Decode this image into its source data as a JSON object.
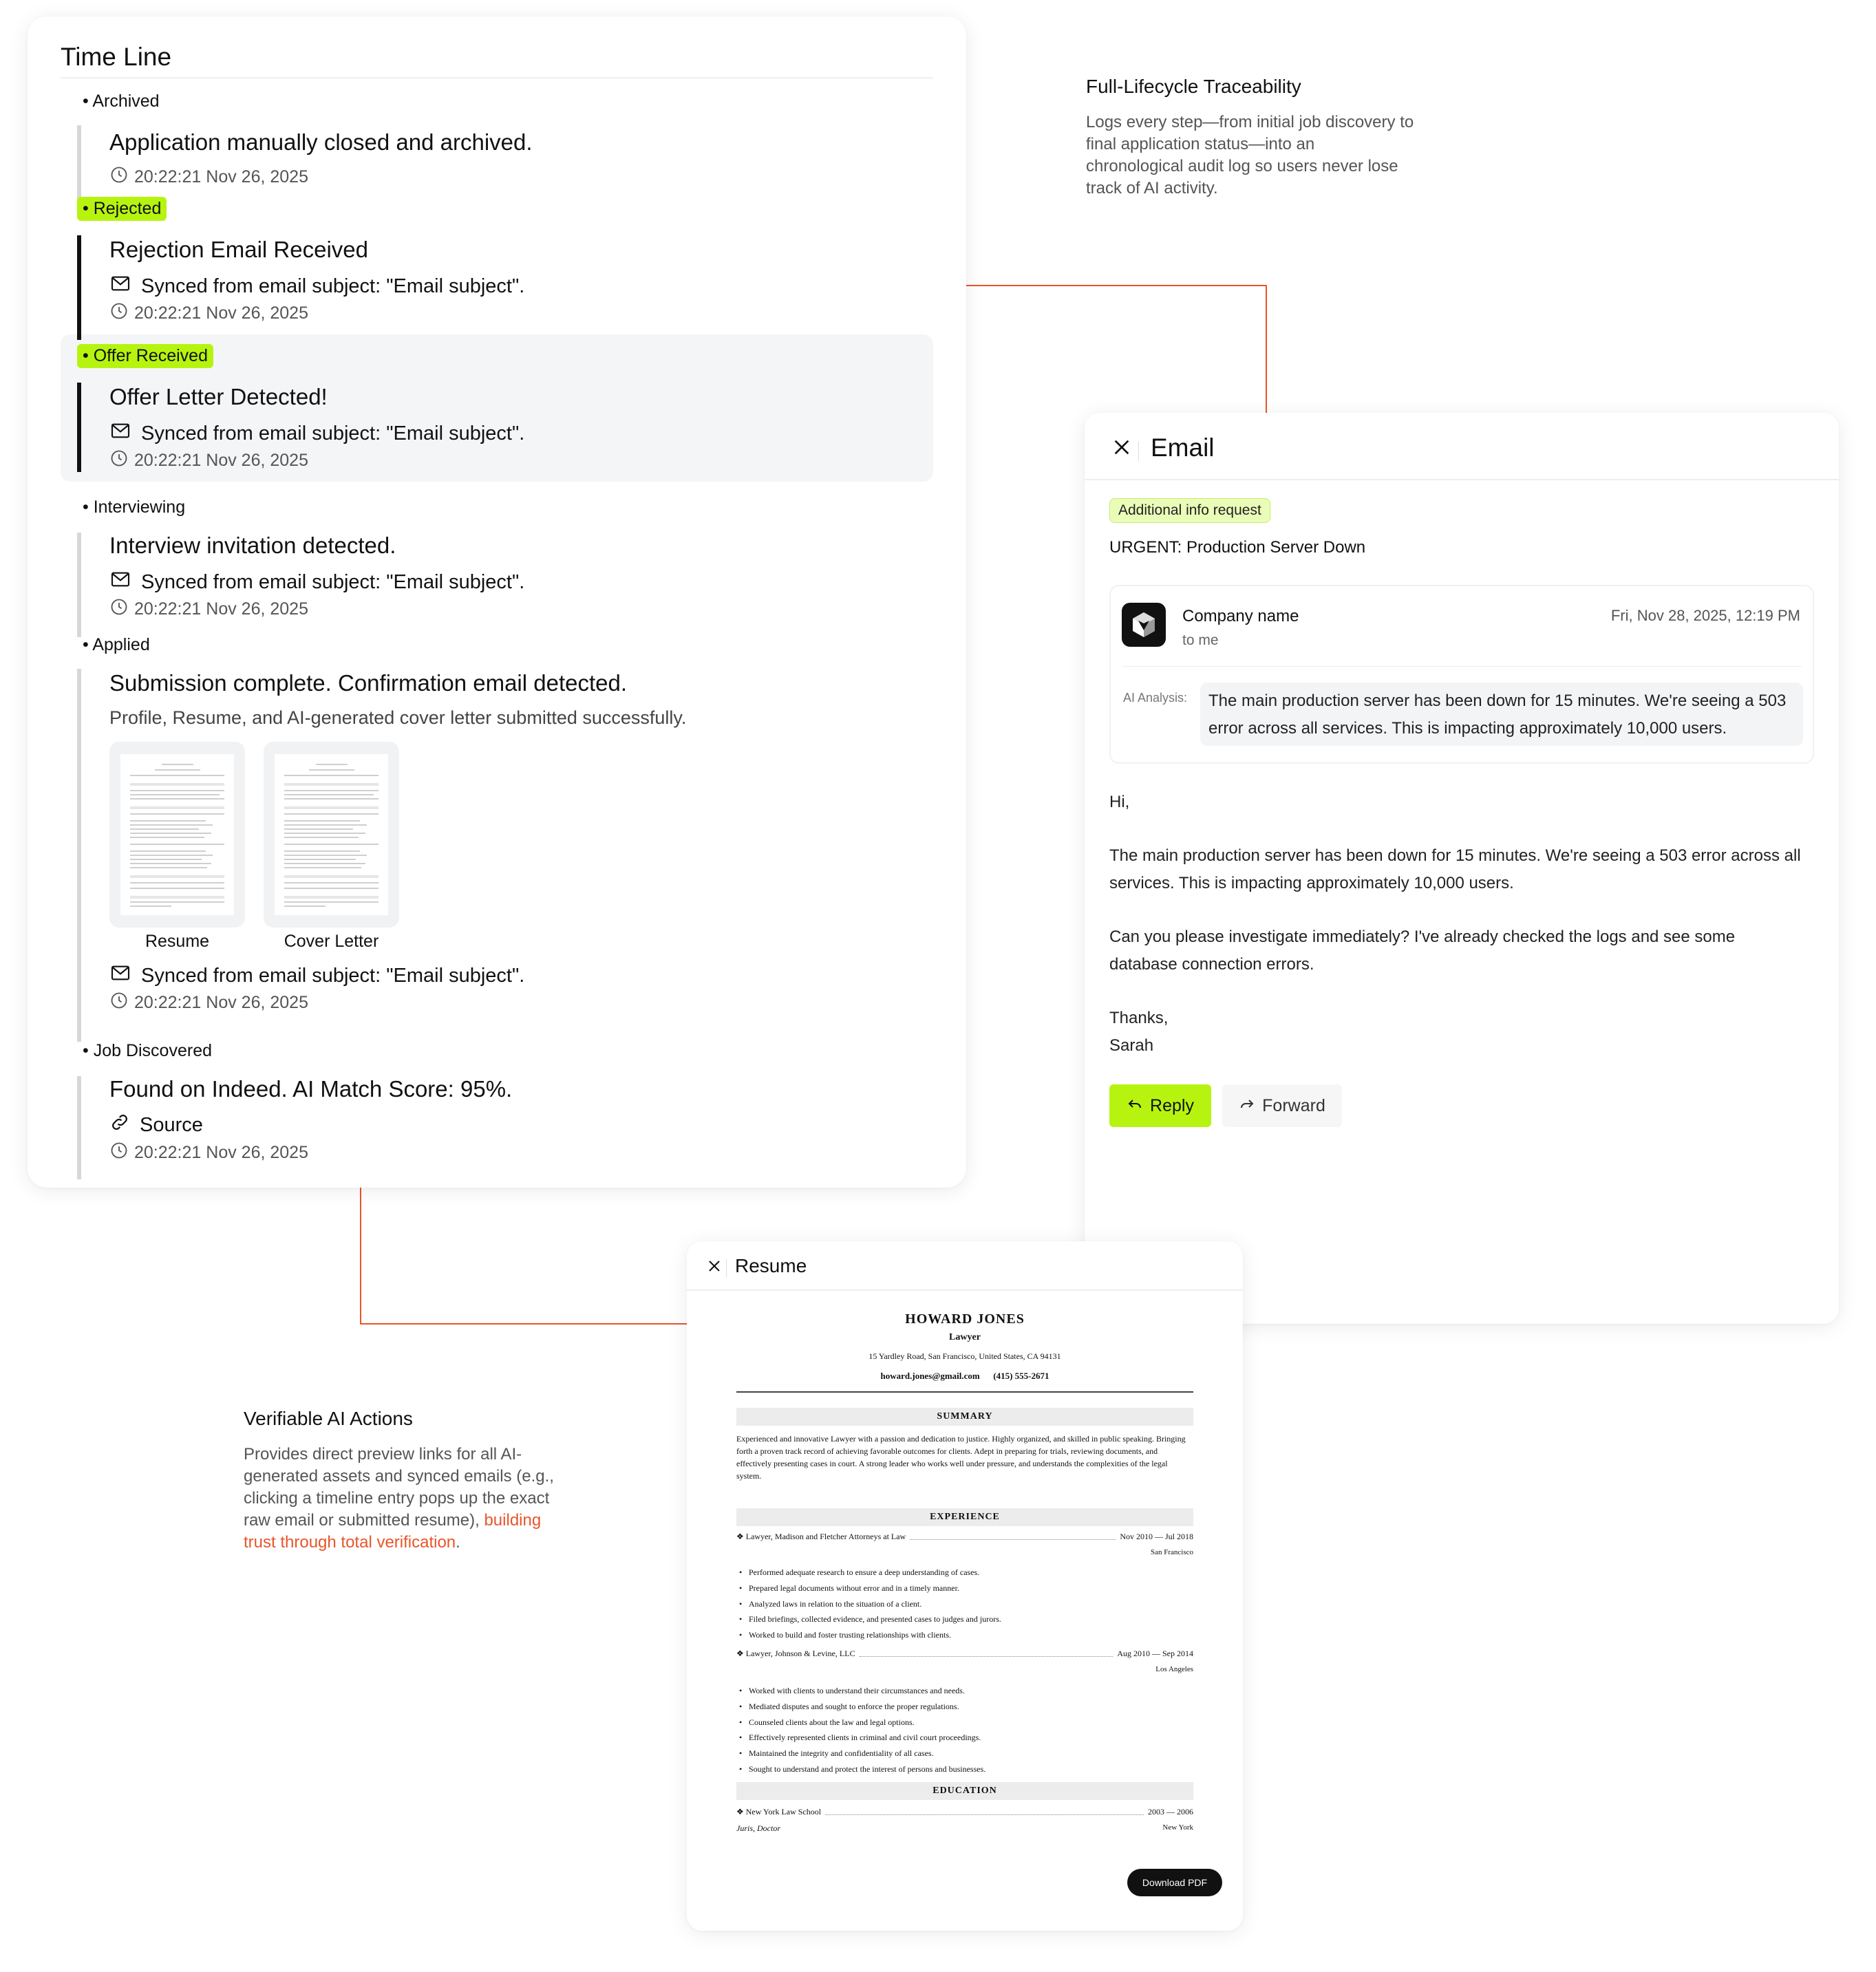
{
  "timeline": {
    "title": "Time Line",
    "entries": [
      {
        "status": "• Archived",
        "title": "Application manually closed and archived.",
        "time": "20:22:21 Nov 26, 2025"
      },
      {
        "status": "• Rejected",
        "title": "Rejection Email Received",
        "synced": "Synced from email subject: \"Email subject\".",
        "time": "20:22:21 Nov 26, 2025"
      },
      {
        "status": "• Offer Received",
        "title": "Offer Letter Detected!",
        "synced": "Synced from email subject: \"Email subject\".",
        "time": "20:22:21 Nov 26, 2025"
      },
      {
        "status": "• Interviewing",
        "title": "Interview invitation detected.",
        "synced": "Synced from email subject: \"Email subject\".",
        "time": "20:22:21 Nov 26, 2025"
      },
      {
        "status": "• Applied",
        "title": "Submission complete. Confirmation email detected.",
        "subtitle": "Profile, Resume, and AI-generated cover letter submitted successfully.",
        "attachments": [
          "Resume",
          "Cover Letter"
        ],
        "synced": "Synced from email subject: \"Email subject\".",
        "time": "20:22:21 Nov 26, 2025"
      },
      {
        "status": "• Job Discovered",
        "title": "Found on Indeed. AI Match Score: 95%.",
        "source": "Source",
        "time": "20:22:21 Nov 26, 2025"
      }
    ]
  },
  "annotations": {
    "traceability": {
      "title": "Full-Lifecycle Traceability",
      "body": "Logs every step—from initial job discovery to final application status—into an chronological audit log so users never lose track of AI activity."
    },
    "verifiable": {
      "title": "Verifiable AI Actions",
      "body": "Provides direct preview links for all AI-generated assets and synced emails (e.g., clicking a timeline entry pops up the exact raw email or submitted resume), ",
      "highlight": "building trust through total verification",
      "end": "."
    }
  },
  "email": {
    "title": "Email",
    "tag": "Additional info request",
    "subject": "URGENT: Production Server Down",
    "sender": "Company name",
    "to": "to me",
    "date": "Fri, Nov 28, 2025, 12:19 PM",
    "ai_label": "AI Analysis:",
    "ai_text": "The main production server has been down for 15 minutes. We're seeing a 503 error across all services. This is impacting approximately 10,000 users.",
    "greeting": "Hi,",
    "para1": "The main production server has been down for 15 minutes. We're seeing a 503 error across all services. This is impacting approximately 10,000 users.",
    "para2": "Can you please investigate immediately? I've already checked the logs and see some database connection errors.",
    "signoff": "Thanks,",
    "signature": "Sarah",
    "reply_label": "Reply",
    "forward_label": "Forward"
  },
  "resume": {
    "title": "Resume",
    "name": "HOWARD JONES",
    "role": "Lawyer",
    "address": "15 Yardley Road, San Francisco, United States, CA 94131",
    "contact": "howard.jones@gmail.com      (415) 555-2671",
    "summary_title": "SUMMARY",
    "summary": "Experienced and innovative Lawyer with a passion and dedication to justice. Highly organized, and skilled in public speaking. Bringing forth a proven track record of achieving favorable outcomes for clients. Adept in preparing for trials, reviewing documents, and effectively presenting cases in court. A strong leader who works well under pressure, and understands the complexities of the legal system.",
    "experience_title": "EXPERIENCE",
    "jobs": [
      {
        "title": "Lawyer, Madison and Fletcher Attorneys at Law",
        "dates": "Nov 2010 — Jul 2018",
        "location": "San Francisco",
        "bullets": [
          "Performed adequate research to ensure a deep understanding of cases.",
          "Prepared legal documents without error and in a timely manner.",
          "Analyzed laws in relation to the situation of a client.",
          "Filed briefings, collected evidence, and presented cases to judges and jurors.",
          "Worked to build and foster trusting relationships with clients."
        ]
      },
      {
        "title": "Lawyer, Johnson & Levine, LLC",
        "dates": "Aug 2010 — Sep 2014",
        "location": "Los Angeles",
        "bullets": [
          "Worked with clients to understand their circumstances and needs.",
          "Mediated disputes and sought to enforce the proper regulations.",
          "Counseled clients about the law and legal options.",
          "Effectively represented clients in criminal and civil court proceedings.",
          "Maintained the integrity and confidentiality of all cases.",
          "Sought to understand and protect the interest of persons and businesses."
        ]
      }
    ],
    "education_title": "EDUCATION",
    "school": "New York Law School",
    "school_dates": "2003 — 2006",
    "degree": "Juris, Doctor",
    "school_location": "New York",
    "download_label": "Download PDF"
  },
  "colors": {
    "accent": "#b6f410",
    "connector": "#e8552b",
    "text": "#111111"
  }
}
